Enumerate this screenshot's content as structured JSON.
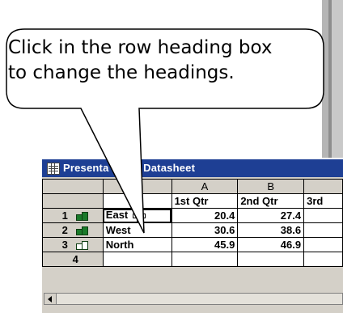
{
  "callout": {
    "line1": "Click in the row heading box",
    "line2": "to change the headings."
  },
  "window": {
    "title": "Presentation - Datasheet",
    "title_visible": "Presenta         - Datasheet",
    "icon": "datasheet-grid-icon"
  },
  "datasheet": {
    "column_letters": [
      "",
      "",
      "A",
      "B",
      ""
    ],
    "column_headings": [
      "",
      "",
      "1st Qtr",
      "2nd Qtr",
      "3rd"
    ],
    "rows": [
      {
        "num": "1",
        "label": "East",
        "values": [
          "20.4",
          "27.4",
          ""
        ],
        "icon": "chart-bars-icon"
      },
      {
        "num": "2",
        "label": "West",
        "values": [
          "30.6",
          "38.6",
          ""
        ],
        "icon": "chart-bars-icon"
      },
      {
        "num": "3",
        "label": "North",
        "values": [
          "45.9",
          "46.9",
          ""
        ],
        "icon": "chart-bars-outline-icon"
      },
      {
        "num": "4",
        "label": "",
        "values": [
          "",
          "",
          ""
        ],
        "icon": ""
      }
    ]
  },
  "cursor": "plus-cross-cursor-icon",
  "colors": {
    "titlebar": "#1e3f94",
    "window_bg": "#d4d0c8",
    "row_icon": "#1a7a2a"
  }
}
